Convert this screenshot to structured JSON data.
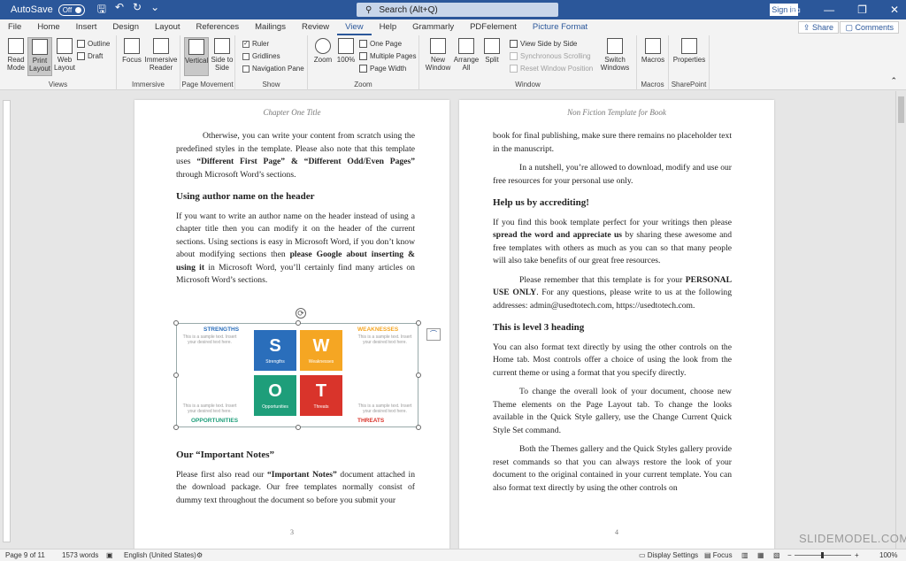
{
  "titlebar": {
    "autosave_label": "AutoSave",
    "autosave_state": "Off",
    "search_placeholder": "Search (Alt+Q)",
    "signin_label": "Sign in",
    "minimize": "—",
    "restore": "❐",
    "close": "✕"
  },
  "tabs": [
    "File",
    "Home",
    "Insert",
    "Design",
    "Layout",
    "References",
    "Mailings",
    "Review",
    "View",
    "Help",
    "Grammarly",
    "PDFelement",
    "Picture Format"
  ],
  "tabbar": {
    "share_label": "Share",
    "comments_label": "Comments"
  },
  "ribbon": {
    "views": {
      "label": "Views",
      "read_mode": "Read Mode",
      "print_layout": "Print Layout",
      "web_layout": "Web Layout",
      "outline": "Outline",
      "draft": "Draft"
    },
    "immersive": {
      "label": "Immersive",
      "focus": "Focus",
      "immersive_reader": "Immersive Reader"
    },
    "page_movement": {
      "label": "Page Movement",
      "vertical": "Vertical",
      "side_to_side": "Side to Side"
    },
    "show": {
      "label": "Show",
      "ruler": "Ruler",
      "gridlines": "Gridlines",
      "navigation_pane": "Navigation Pane"
    },
    "zoom": {
      "label": "Zoom",
      "zoom": "Zoom",
      "hundred": "100%",
      "one_page": "One Page",
      "multiple_pages": "Multiple Pages",
      "page_width": "Page Width"
    },
    "window": {
      "label": "Window",
      "new_window": "New Window",
      "arrange_all": "Arrange All",
      "split": "Split",
      "view_side_by_side": "View Side by Side",
      "sync_scrolling": "Synchronous Scrolling",
      "reset_window": "Reset Window Position",
      "switch_windows": "Switch Windows"
    },
    "macros": {
      "label": "Macros",
      "macros": "Macros"
    },
    "sharepoint": {
      "label": "SharePoint",
      "properties": "Properties"
    }
  },
  "page_left": {
    "header": "Chapter One Title",
    "number": "3",
    "p1_a": "Otherwise, you can write your content from scratch using the predefined styles in the template. Please also note that this template uses ",
    "p1_b": "“Different First Page” & “Different Odd/Even Pages”",
    "p1_c": " through Microsoft Word’s sections.",
    "h_author": "Using author name on the header",
    "p2_a": "If you want to write an author name on the header instead of using a chapter title then you can modify it on the header of the current sections. Using sections is easy in Microsoft Word, if you don’t know about modifying sections then ",
    "p2_b": "please Google about inserting & using it",
    "p2_c": " in Microsoft Word, you’ll certainly find many articles on Microsoft Word’s sections.",
    "h_notes": "Our “Important Notes”",
    "p3_a": "Please first also read our ",
    "p3_b": "“Important Notes”",
    "p3_c": " document attached in the download package. Our free templates normally consist of dummy text throughout the document so before you submit your"
  },
  "swot": {
    "strengths": "STRENGTHS",
    "weaknesses": "WEAKNESSES",
    "opportunities": "OPPORTUNITIES",
    "threats": "THREATS",
    "sample": "This is a sample text. Insert your desired text here.",
    "s": "S",
    "w": "W",
    "o": "O",
    "t": "T",
    "s_label": "Strengths",
    "w_label": "Weaknesses",
    "o_label": "Opportunities",
    "t_label": "Threats",
    "colors": {
      "s": "#2a6ebb",
      "w": "#f5a623",
      "o": "#1e9e7a",
      "t": "#d9342b"
    }
  },
  "page_right": {
    "header": "Non Fiction Template for Book",
    "number": "4",
    "p1": "book for final publishing, make sure there remains no placeholder text in the manuscript.",
    "p2": "In a nutshell, you’re allowed to download, modify and use our free resources for your personal use only.",
    "h_help": "Help us by accrediting!",
    "p3_a": "If you find this book template perfect for your writings then please ",
    "p3_b": "spread the word and appreciate us",
    "p3_c": " by sharing these awesome and free templates with others as much as you can so that many people will also take benefits of our great free resources.",
    "p4_a": "Please remember that this template is for your ",
    "p4_b": "PERSONAL USE ONLY",
    "p4_c": ". For any questions, please write to us at the following addresses: admin@usedtotech.com, https://usedtotech.com.",
    "h_level3": "This is level 3 heading",
    "p5": "You can also format text directly by using the other controls on the Home tab. Most controls offer a choice of using the look from the current theme or using a format that you specify directly.",
    "p6": "To change the overall look of your document, choose new Theme elements on the Page Layout tab. To change the looks available in the Quick Style gallery, use the Change Current Quick Style Set command.",
    "p7": "Both the Themes gallery and the Quick Styles gallery provide reset commands so that you can always restore the look of your document to the original contained in your current template. You can also format text directly by using the other controls on"
  },
  "statusbar": {
    "page": "Page 9 of 11",
    "words": "1573 words",
    "language": "English (United States)",
    "display_settings": "Display Settings",
    "focus": "Focus",
    "zoom_minus": "−",
    "zoom_plus": "+",
    "zoom_level": "100%"
  },
  "watermark": "SLIDEMODEL.COM"
}
